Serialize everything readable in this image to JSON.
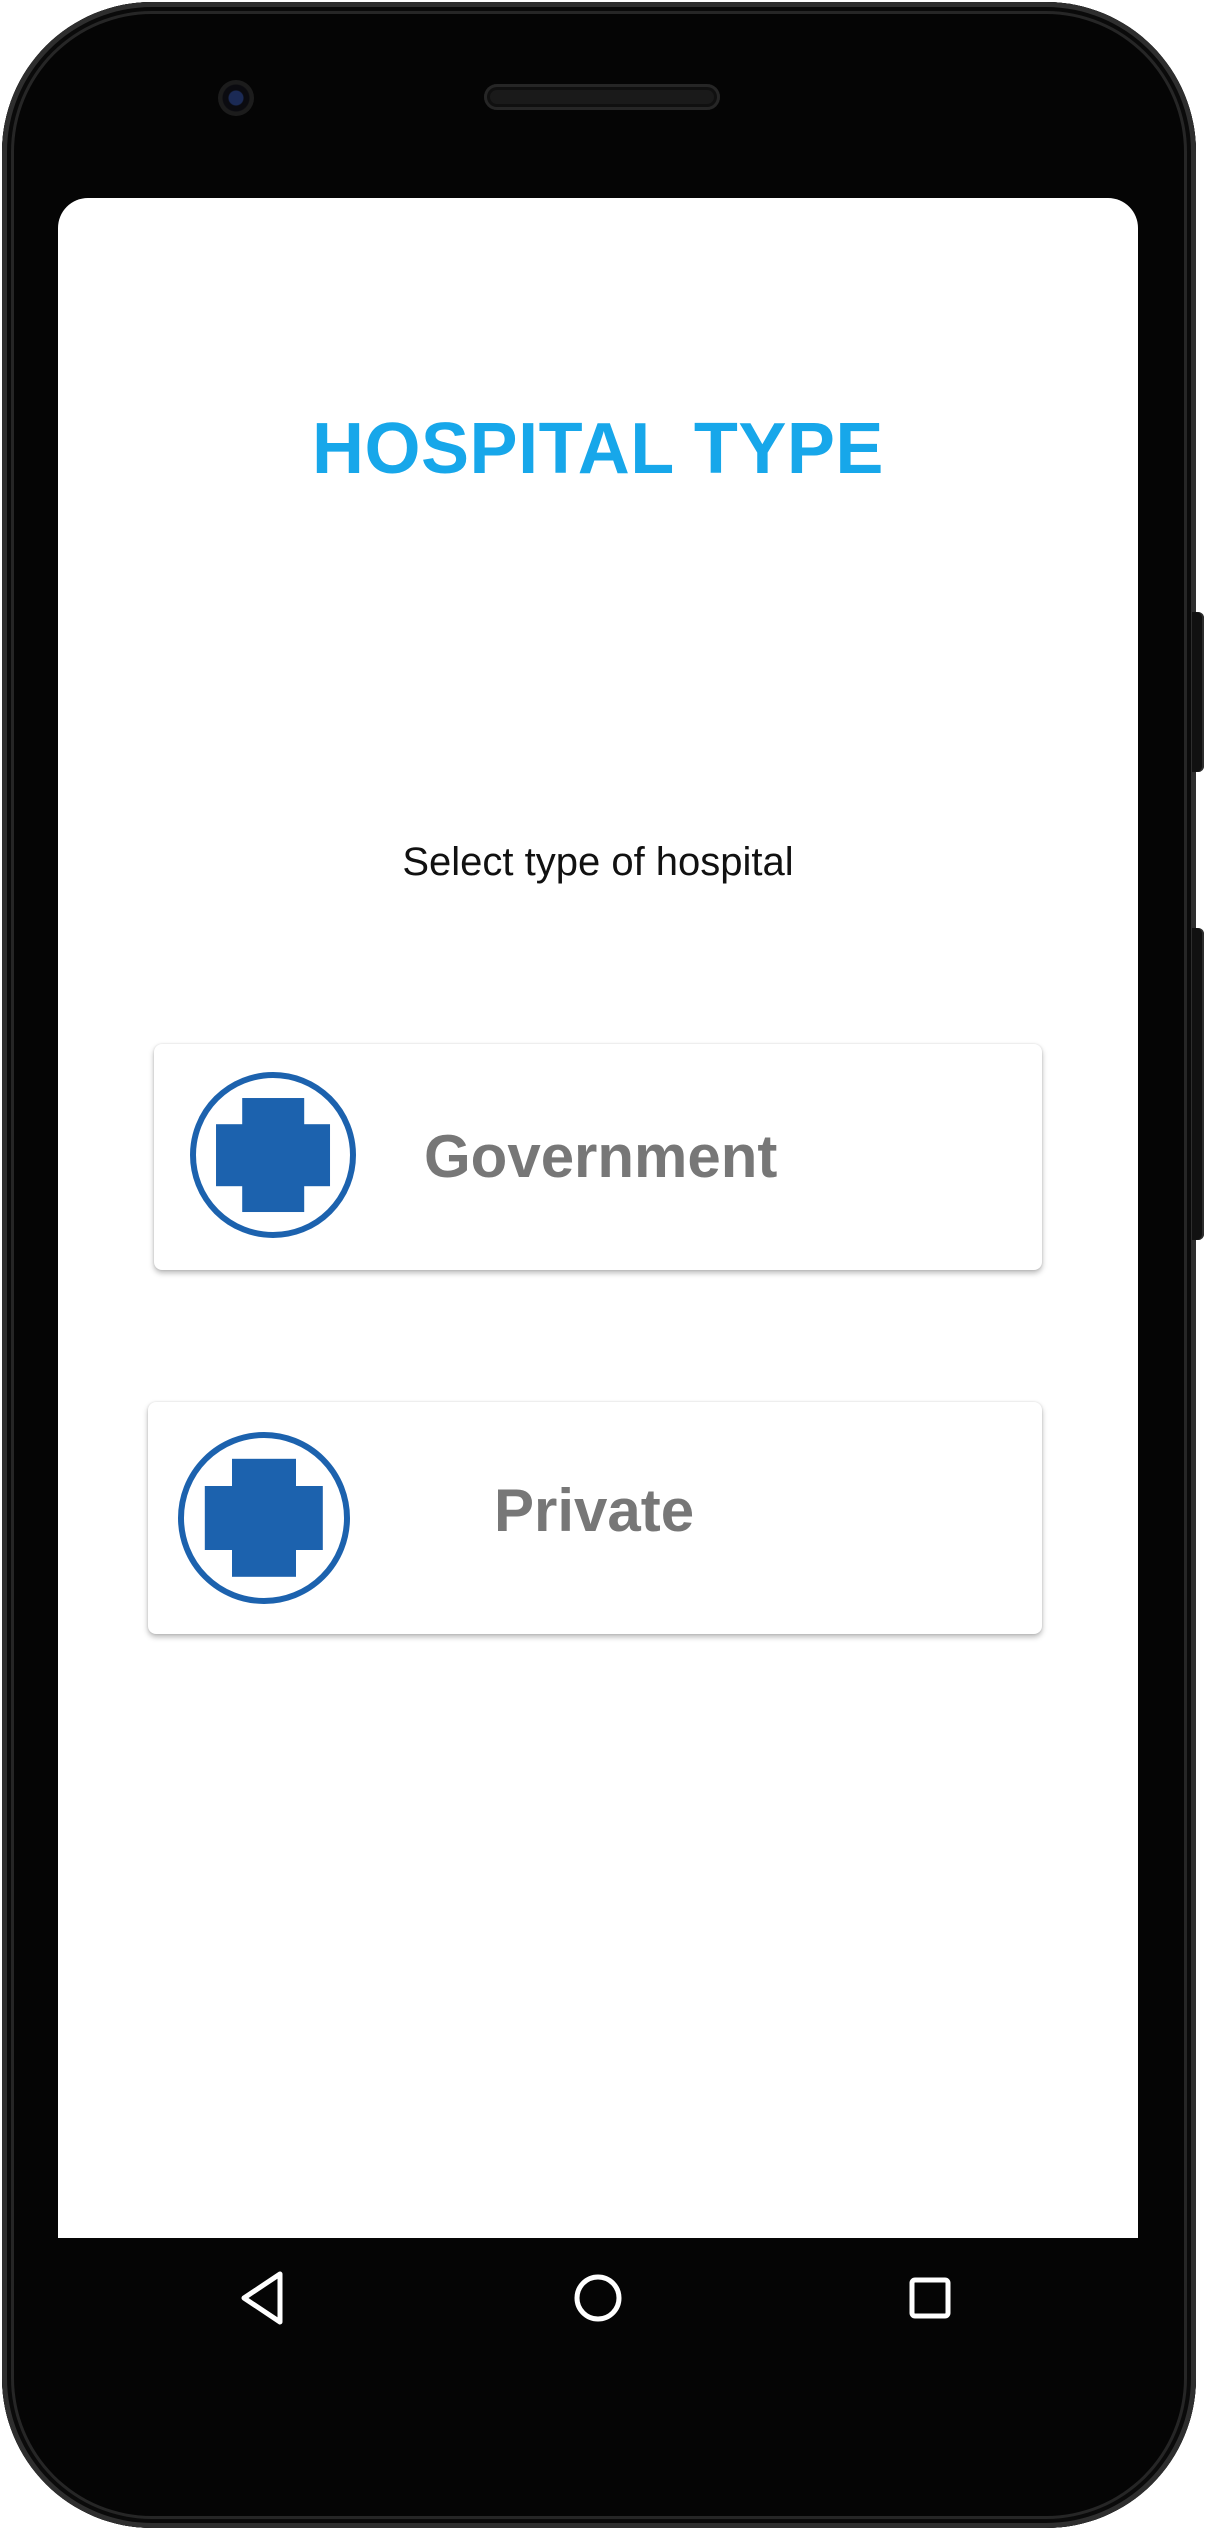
{
  "header": {
    "title": "HOSPITAL TYPE"
  },
  "main": {
    "prompt": "Select type of hospital",
    "options": [
      {
        "label": "Government",
        "icon": "medical-cross-icon"
      },
      {
        "label": "Private",
        "icon": "medical-cross-icon"
      }
    ]
  },
  "navigation": {
    "buttons": [
      {
        "icon": "back-triangle-icon"
      },
      {
        "icon": "home-circle-icon"
      },
      {
        "icon": "recents-square-icon"
      }
    ]
  },
  "colors": {
    "title": "#17a7ea",
    "icon": "#1c62ae",
    "card_label": "#777777",
    "prompt": "#111111"
  }
}
